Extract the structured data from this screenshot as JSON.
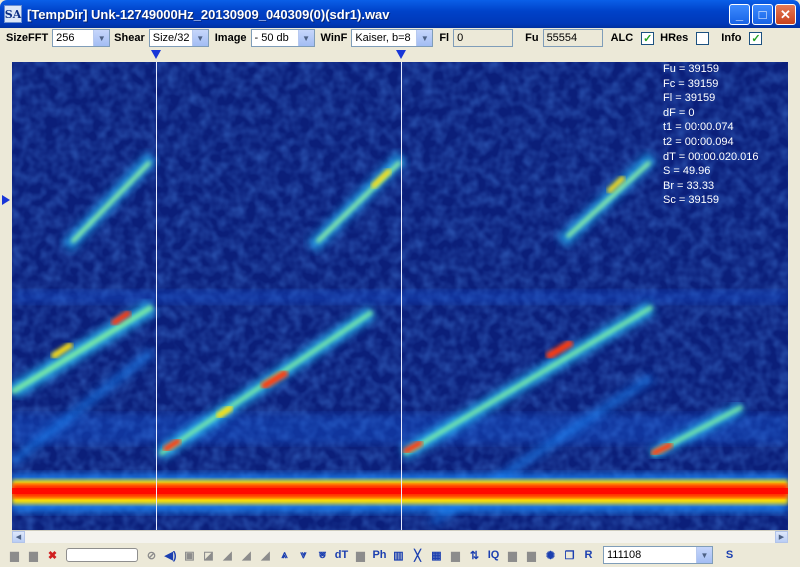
{
  "window": {
    "title": "[TempDir] Unk-12749000Hz_20130909_040309(0)(sdr1).wav",
    "app_icon_text": "SA",
    "minimize_glyph": "_",
    "maximize_glyph": "□",
    "close_glyph": "✕"
  },
  "toolbar": {
    "sizefft_label": "SizeFFT",
    "sizefft_value": "256",
    "shear_label": "Shear",
    "shear_value": "Size/32",
    "image_label": "Image",
    "image_value": "- 50 db",
    "winf_label": "WinF",
    "winf_value": "Kaiser, b=8",
    "fl_label": "Fl",
    "fl_value": "0",
    "fu_label": "Fu",
    "fu_value": "55554",
    "alc_label": "ALC",
    "alc_checked": true,
    "hres_label": "HRes",
    "hres_checked": false,
    "info_label": "Info",
    "info_checked": true
  },
  "info": {
    "fu": "Fu = 39159",
    "fc": "Fc = 39159",
    "fl": "Fl = 39159",
    "df": "dF = 0",
    "t1": "t1 = 00:00.074",
    "t2": "t2 = 00:00.094",
    "dt": "dT = 00:00.020.016",
    "s": "S = 49.96",
    "br": "Br = 33.33",
    "sc": "Sc = 39159"
  },
  "cursors": {
    "t1_fraction": 0.186,
    "t2_fraction": 0.501
  },
  "bottom": {
    "dt_label": "dT",
    "ph_label": "Ph",
    "iq_label": "IQ",
    "r_label": "R",
    "s_label": "S",
    "frequency_value": "111108"
  },
  "icons": [
    "folder-icon",
    "save-icon",
    "delete-icon",
    "stop-icon",
    "speaker-icon",
    "filter-icon",
    "marker-icon",
    "zoom-icon"
  ],
  "colors": {
    "background": "#0a1e70",
    "signal_hot": "#ff2a00",
    "signal_warm": "#ffd400",
    "signal_cool": "#33e0ff",
    "cursor": "#e8ecff"
  }
}
